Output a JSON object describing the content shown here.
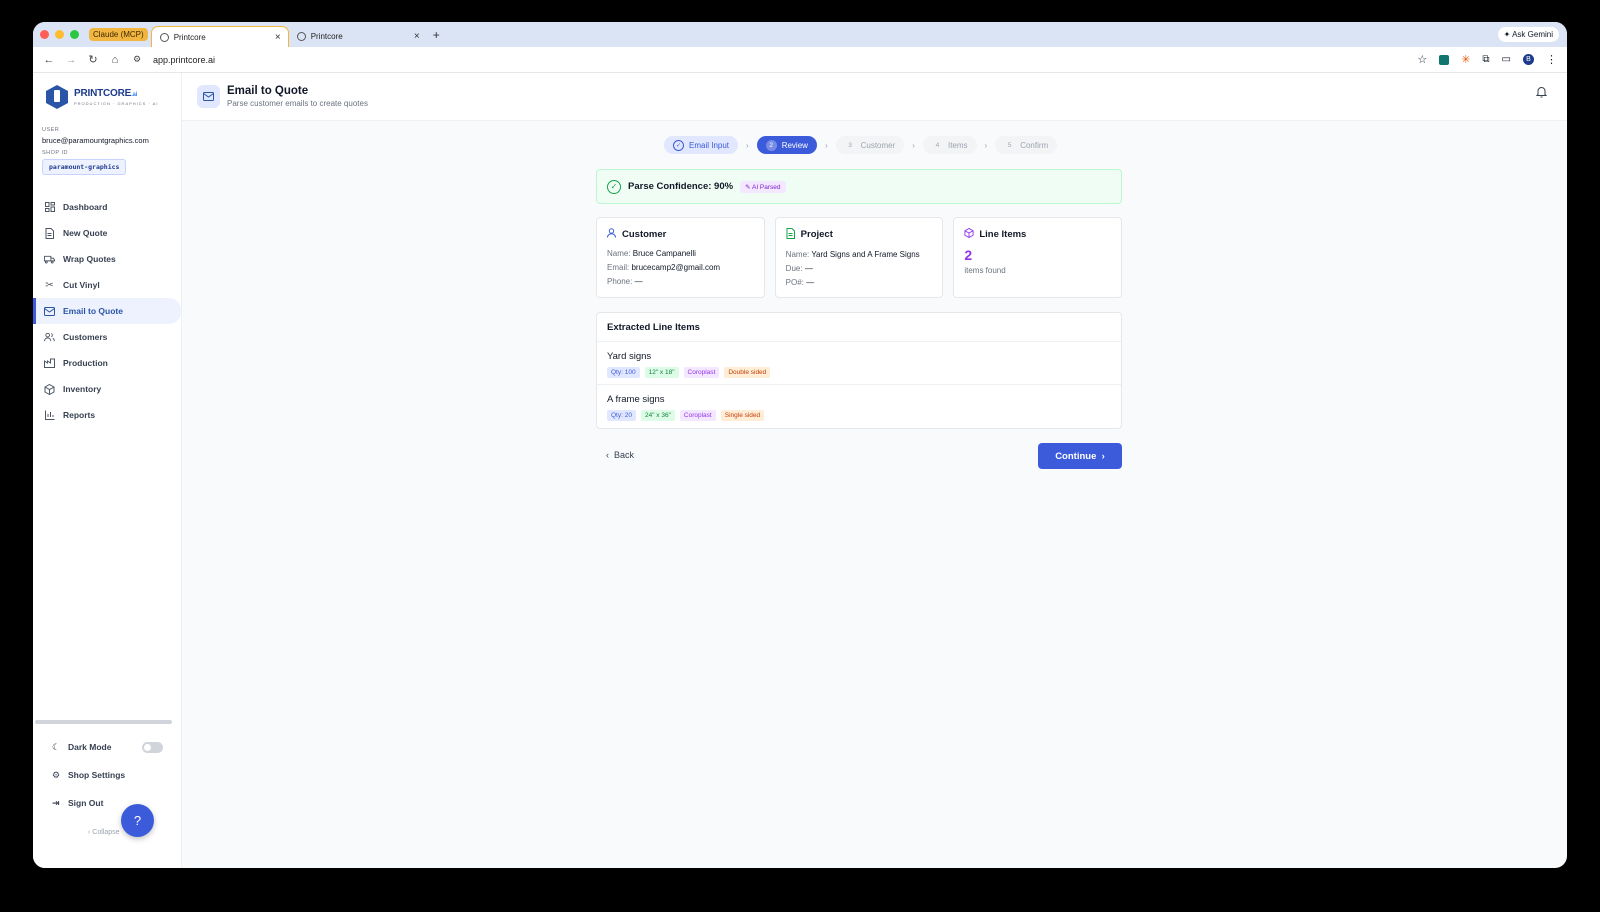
{
  "browser": {
    "tab_group": "Claude (MCP)",
    "tabs": [
      {
        "label": "Printcore"
      },
      {
        "label": "Printcore"
      }
    ],
    "new_tab": "+",
    "ask_gemini": "Ask Gemini",
    "url": "app.printcore.ai",
    "profile_initial": "B"
  },
  "sidebar": {
    "logo_main": "PRINTCORE",
    "logo_suffix": ".ai",
    "logo_tagline": "PRODUCTION · GRAPHICS · AI",
    "user_label": "USER",
    "user_email": "bruce@paramountgraphics.com",
    "shop_label": "SHOP ID",
    "shop_id": "paramount-graphics",
    "items": [
      {
        "label": "Dashboard",
        "icon": "grid-icon"
      },
      {
        "label": "New Quote",
        "icon": "document-icon"
      },
      {
        "label": "Wrap Quotes",
        "icon": "truck-icon"
      },
      {
        "label": "Cut Vinyl",
        "icon": "scissors-icon"
      },
      {
        "label": "Email to Quote",
        "icon": "mail-icon"
      },
      {
        "label": "Customers",
        "icon": "users-icon"
      },
      {
        "label": "Production",
        "icon": "factory-icon"
      },
      {
        "label": "Inventory",
        "icon": "box-icon"
      },
      {
        "label": "Reports",
        "icon": "chart-icon"
      }
    ],
    "dark_mode": "Dark Mode",
    "shop_settings": "Shop Settings",
    "sign_out": "Sign Out",
    "collapse": "Collapse"
  },
  "header": {
    "title": "Email to Quote",
    "subtitle": "Parse customer emails to create quotes"
  },
  "steps": [
    {
      "num": "✓",
      "label": "Email Input",
      "state": "done"
    },
    {
      "num": "2",
      "label": "Review",
      "state": "current"
    },
    {
      "num": "3",
      "label": "Customer",
      "state": "todo"
    },
    {
      "num": "4",
      "label": "Items",
      "state": "todo"
    },
    {
      "num": "5",
      "label": "Confirm",
      "state": "todo"
    }
  ],
  "confidence": {
    "text": "Parse Confidence: 90%",
    "badge": "AI Parsed"
  },
  "customer": {
    "title": "Customer",
    "name_label": "Name:",
    "name": "Bruce Campanelli",
    "email_label": "Email:",
    "email": "brucecamp2@gmail.com",
    "phone_label": "Phone:",
    "phone": "—"
  },
  "project": {
    "title": "Project",
    "name_label": "Name:",
    "name": "Yard Signs and A Frame Signs",
    "due_label": "Due:",
    "due": "—",
    "po_label": "PO#:",
    "po": "—"
  },
  "line_items_card": {
    "title": "Line Items",
    "count": "2",
    "caption": "items found"
  },
  "extracted": {
    "title": "Extracted Line Items",
    "items": [
      {
        "name": "Yard signs",
        "qty": "Qty: 100",
        "size": "12\" x 18\"",
        "material": "Coroplast",
        "sides": "Double sided"
      },
      {
        "name": "A frame signs",
        "qty": "Qty: 20",
        "size": "24\" x 36\"",
        "material": "Coroplast",
        "sides": "Single sided"
      }
    ]
  },
  "actions": {
    "back": "Back",
    "continue": "Continue"
  }
}
